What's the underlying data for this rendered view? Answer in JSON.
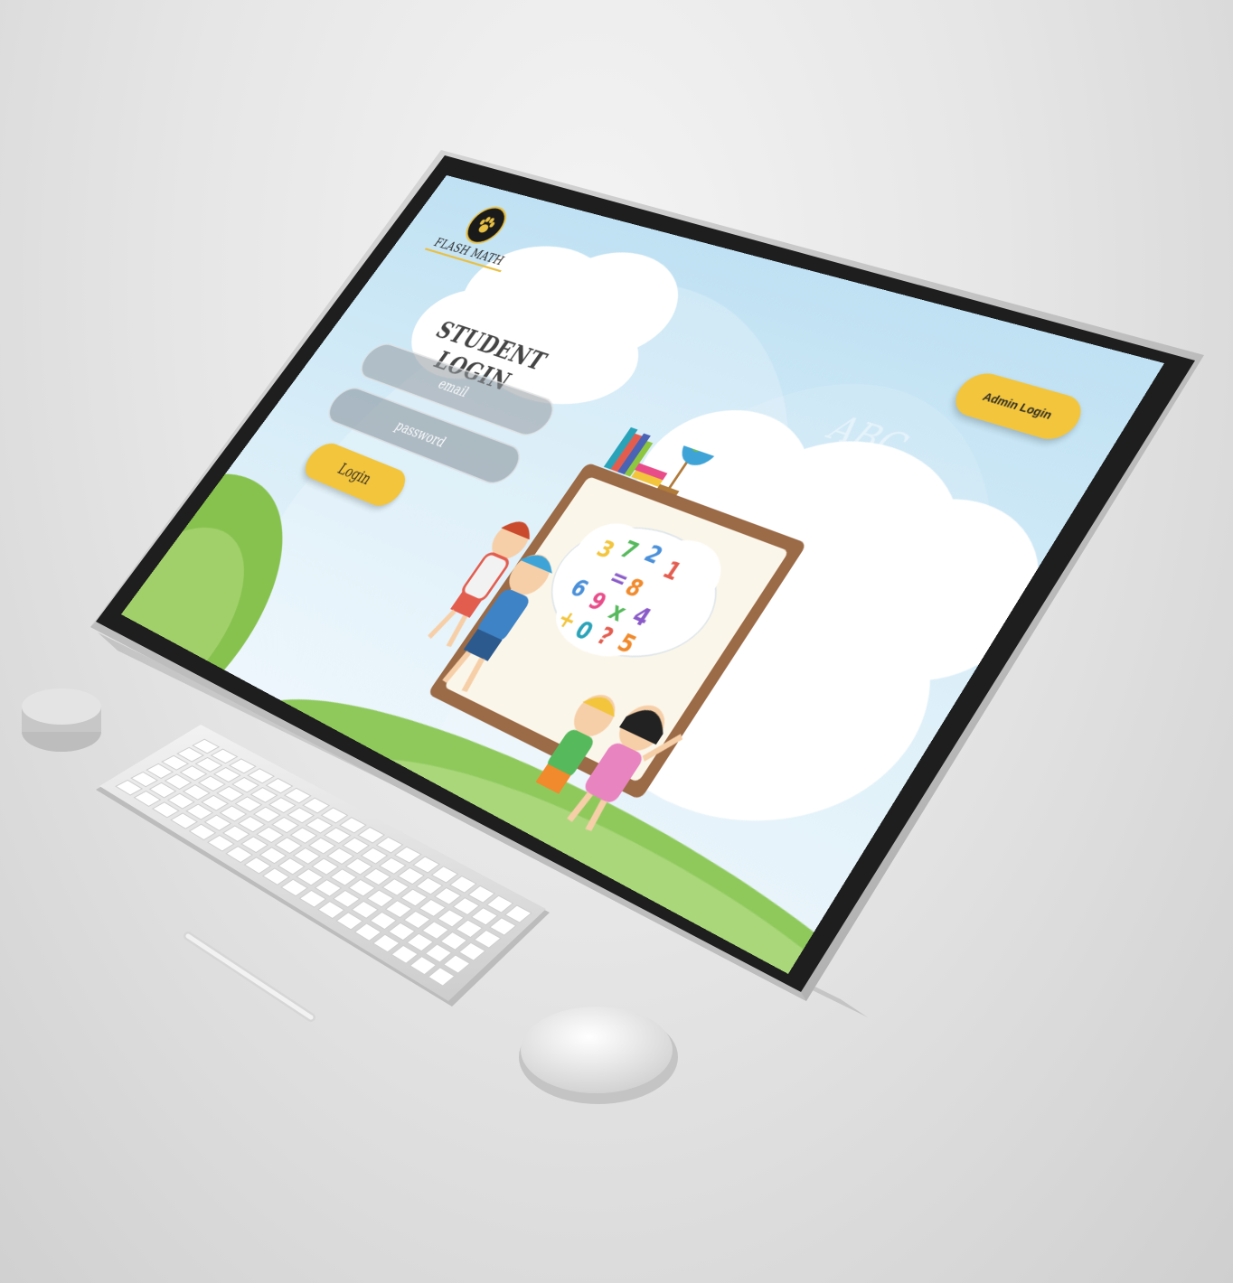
{
  "app": {
    "logo_text": "FLASH MATH"
  },
  "login": {
    "title": "STUDENT LOGIN",
    "email_placeholder": "email",
    "password_placeholder": "password",
    "login_label": "Login"
  },
  "header": {
    "admin_login_label": "Admin Login"
  },
  "illustration": {
    "board_numbers": [
      "3",
      "7",
      "2",
      "1",
      "=",
      "8",
      "6",
      "9",
      "x",
      "4",
      "+",
      "0",
      "?",
      "5"
    ]
  },
  "colors": {
    "accent_yellow": "#f2c53d",
    "sky_blue": "#c6e5f5",
    "grass_green": "#8fc95c",
    "monitor_bezel": "#1e1e1e",
    "monitor_frame": "#c9c9c9"
  },
  "icons": {
    "logo": "paw-icon"
  }
}
